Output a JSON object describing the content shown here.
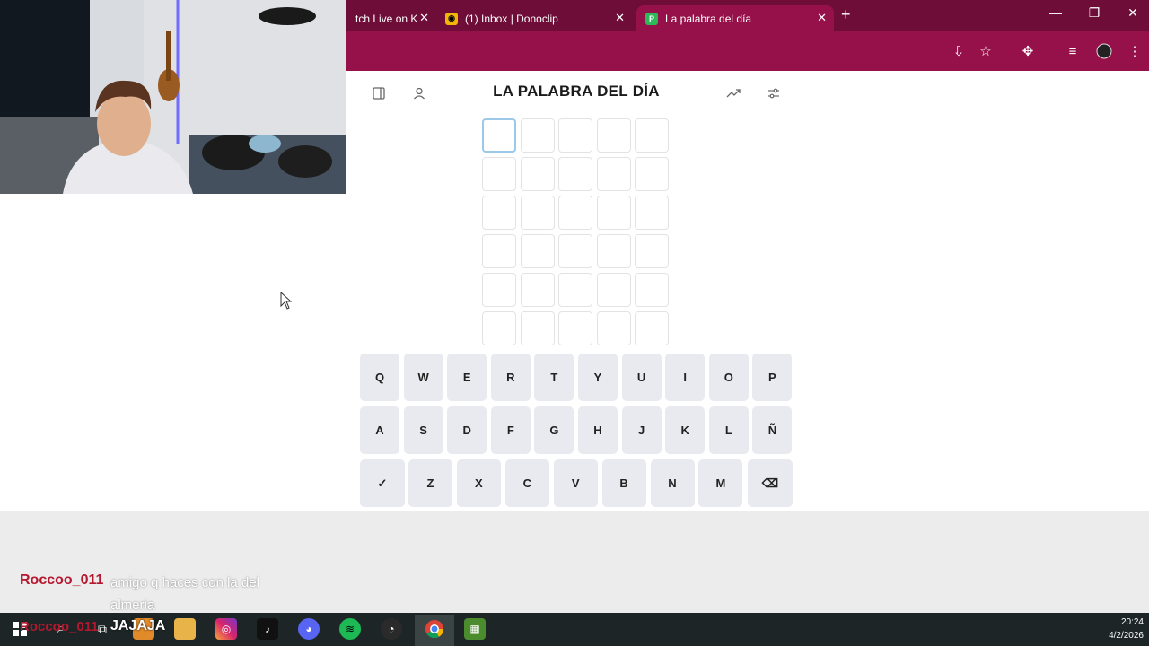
{
  "browser": {
    "tabs": [
      {
        "label": "tch Live on K",
        "favicon": "kick-icon"
      },
      {
        "label": "(1) Inbox | Donoclip",
        "favicon": "donoclip-icon"
      },
      {
        "label": "La palabra del día",
        "favicon": "palabra-icon",
        "favicon_letter": "P",
        "active": true
      }
    ],
    "new_tab": "+",
    "colors": {
      "tabbar": "#6e0d37",
      "toolbar": "#96104a"
    }
  },
  "game": {
    "title": "LA PALABRA DEL DÍA",
    "board": {
      "rows": 6,
      "cols": 5,
      "focused_row": 0,
      "focused_col": 0
    },
    "keyboard": {
      "row1": [
        "Q",
        "W",
        "E",
        "R",
        "T",
        "Y",
        "U",
        "I",
        "O",
        "P"
      ],
      "row2": [
        "A",
        "S",
        "D",
        "F",
        "G",
        "H",
        "J",
        "K",
        "L",
        "Ñ"
      ],
      "row3": [
        "Z",
        "X",
        "C",
        "V",
        "B",
        "N",
        "M"
      ],
      "enter_symbol": "✓",
      "backspace_symbol": "⌫"
    }
  },
  "chat": {
    "username": "Roccoo_011",
    "message": "amigo q haces con la del almeria",
    "overlay_user": "Roccoo_011",
    "overlay_message": "JAJAJA"
  },
  "taskbar": {
    "time": "20:24",
    "date": "4/2/2026"
  }
}
